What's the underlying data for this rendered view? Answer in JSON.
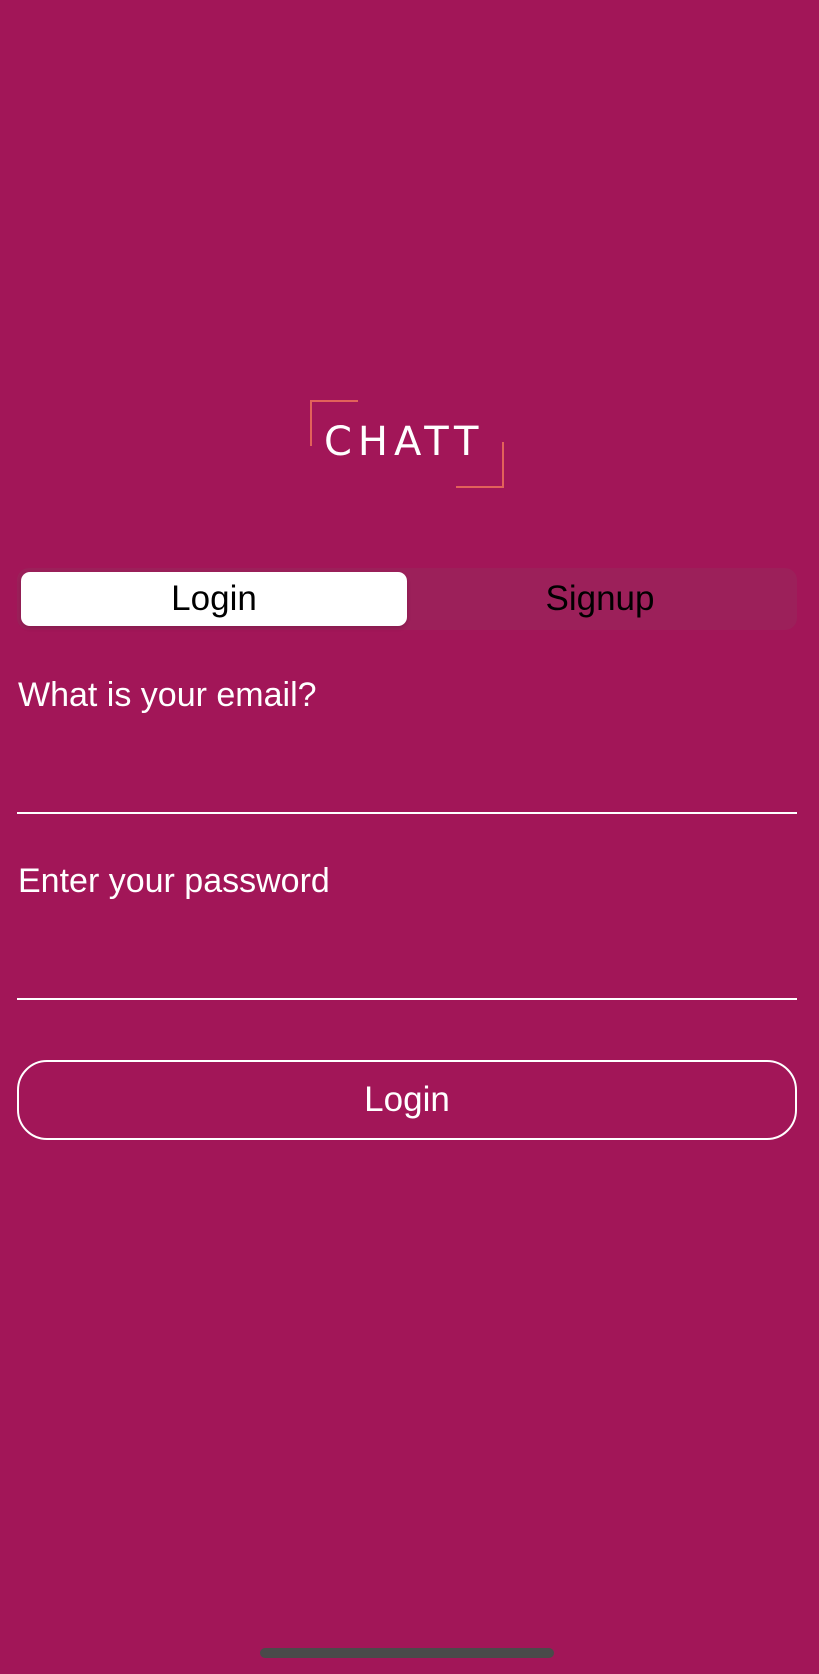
{
  "logo": {
    "text": "CHATT",
    "accent_color": "#e2625a"
  },
  "tabs": [
    {
      "label": "Login",
      "selected": true
    },
    {
      "label": "Signup",
      "selected": false
    }
  ],
  "form": {
    "email_label": "What is your email?",
    "email_value": "",
    "password_label": "Enter your password",
    "password_value": ""
  },
  "login_button": {
    "label": "Login"
  },
  "colors": {
    "background": "#a21658",
    "segment_background": "#9c205a",
    "text": "#ffffff"
  }
}
